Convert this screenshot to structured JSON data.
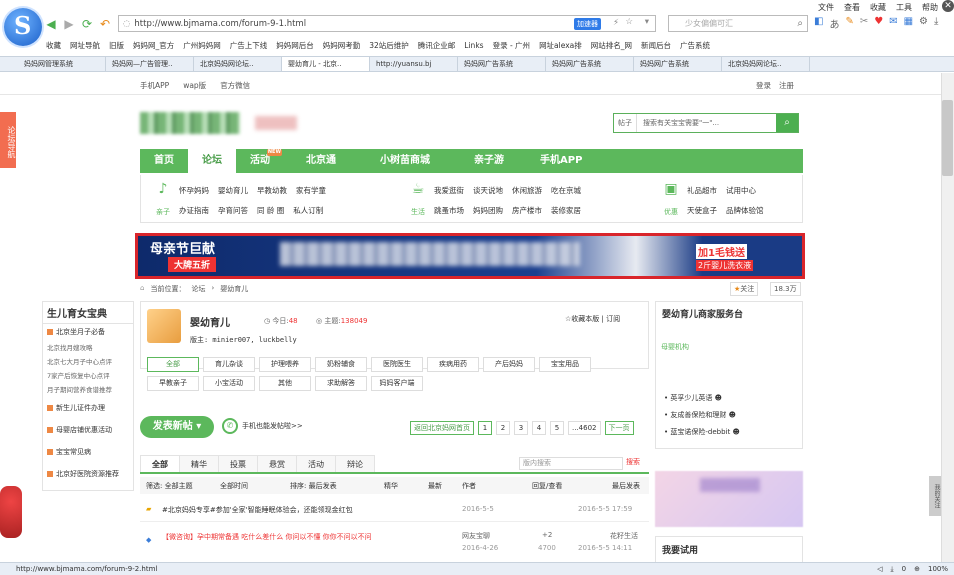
{
  "browser": {
    "menu": [
      "文件",
      "查看",
      "收藏",
      "工具",
      "帮助"
    ],
    "url": "http://www.bjmama.com/forum-9-1.html",
    "accelerate_label": "加速器",
    "search_placeholder": "少女偏偏可汇",
    "favorites": [
      "收藏",
      "网址导航",
      "旧版",
      "妈妈网_官方",
      "广州妈妈网",
      "广告上下线",
      "妈妈网后台",
      "妈妈网考勤",
      "32站后维护",
      "腾讯企业邮",
      "Links",
      "登录 - 广州",
      "网址alexa排",
      "网站排名_网",
      "新闻后台",
      "广告系统"
    ],
    "tabs": [
      "妈妈网管理系统",
      "妈妈网—广告管理..",
      "北京妈妈网论坛..",
      "婴幼育儿 - 北京..",
      "http://yuansu.bj",
      "妈妈网广告系统",
      "妈妈网广告系统",
      "妈妈网广告系统",
      "北京妈妈网论坛.."
    ],
    "active_tab_index": 3,
    "status_url": "http://www.bjmama.com/forum-9-2.html",
    "zoom": "100%",
    "status_count": "0"
  },
  "site": {
    "top_links": [
      "手机APP",
      "wap版",
      "官方微信"
    ],
    "login": "登录",
    "register": "注册",
    "search_select": "帖子",
    "search_placeholder": "搜索有关宝宝需要\"一\"...",
    "side_nav_label": "论坛导航",
    "nav": [
      "首页",
      "论坛",
      "活动",
      "北京通",
      "小树苗商城",
      "亲子游",
      "手机APP"
    ],
    "nav_active": "论坛",
    "sub_groups": [
      {
        "icon_label": "亲子",
        "row1": [
          "怀孕妈妈",
          "婴幼育儿",
          "早教幼教",
          "家有学童"
        ],
        "row2": [
          "办证指南",
          "孕育问答",
          "同 龄 圈",
          "私人订制"
        ]
      },
      {
        "icon_label": "生活",
        "row1": [
          "我爱逛街",
          "谈天说地",
          "休闲旅游",
          "吃在京城"
        ],
        "row2": [
          "跳蚤市场",
          "妈妈团购",
          "房产楼市",
          "装修家居"
        ]
      },
      {
        "icon_label": "优惠",
        "row1": [
          "礼品超市",
          "试用中心"
        ],
        "row2": [
          "天使盒子",
          "品牌体验馆"
        ]
      }
    ],
    "banner": {
      "headline": "母亲节巨献",
      "tag": "大牌五折",
      "right1": "加1毛钱送",
      "right2": "2斤婴儿洗衣液"
    },
    "breadcrumb": [
      "当前位置：",
      "论坛",
      "婴幼育儿"
    ],
    "follow_label": "关注",
    "follow_count": "18.3万"
  },
  "sidebar": {
    "title": "生儿育女宝典",
    "title_highlight": "",
    "sections": [
      {
        "head": "北京坐月子必备",
        "links": [
          "北京找月嫂攻略",
          "北京七大月子中心点评",
          "7家产后恢复中心点评",
          "月子期间营养食谱推荐"
        ]
      },
      {
        "head": "新生儿证件办理",
        "links": []
      },
      {
        "head": "母婴店铺优惠活动",
        "links": []
      },
      {
        "head": "宝宝常见病",
        "links": []
      },
      {
        "head": "北京好医院资源推荐",
        "links": []
      }
    ]
  },
  "forum": {
    "title": "婴幼育儿",
    "today_label": "今日:",
    "today": "48",
    "topics_label": "主题:",
    "topics": "138049",
    "moderators": "版主: minier007, luckbelly",
    "favorite": "收藏本版",
    "subscribe": "订阅",
    "categories": [
      "全部",
      "育儿杂谈",
      "护理喂养",
      "奶粉辅食",
      "医院医生",
      "疾病用药",
      "产后妈妈",
      "宝宝用品",
      "早教亲子",
      "小宝活动",
      "其他",
      "求助解答",
      "妈妈客户端"
    ],
    "post_button": "发表新帖",
    "phone_label": "手机也能发帖啦>>",
    "return_label": "返回北京妈网首页",
    "pages": [
      "1",
      "2",
      "3",
      "4",
      "5",
      "...4602",
      "下一页"
    ],
    "tabs": [
      "全部",
      "精华",
      "投票",
      "悬赏",
      "活动",
      "辩论"
    ],
    "search_placeholder": "版内搜索",
    "search_btn": "搜索",
    "thead": {
      "filter": "筛选: 全部主题",
      "time": "全部时间",
      "sort": "排序: 最后发表",
      "hot": "精华",
      "newest": "最新",
      "author": "作者",
      "replies": "回复/查看",
      "last": "最后发表"
    },
    "rows": [
      {
        "title": "#北京妈妈专享#参加'全家'智能睡眠体验会，还能领现金红包",
        "author": "",
        "date": "2016-5-5",
        "replies": "",
        "views": "",
        "last": "2016-5-5 17:59"
      },
      {
        "title": "【微咨询】孕中期常备遇 吃什么差什么 你问以不懂 你你不问以不问",
        "author": "网友宝聊",
        "date": "2016-4-26",
        "replies": "+2",
        "views": "4700",
        "last": "2016-5-5 14:11",
        "last_user": "花籽生活"
      }
    ]
  },
  "right": {
    "title": "婴幼育儿商家服务台",
    "sub": "母婴机构",
    "items": [
      "英孚少儿英语",
      "友成善保险和理财",
      "蓝宝诺保险-debbit"
    ],
    "try_title": "我要试用",
    "side_widget": "我的关注"
  }
}
